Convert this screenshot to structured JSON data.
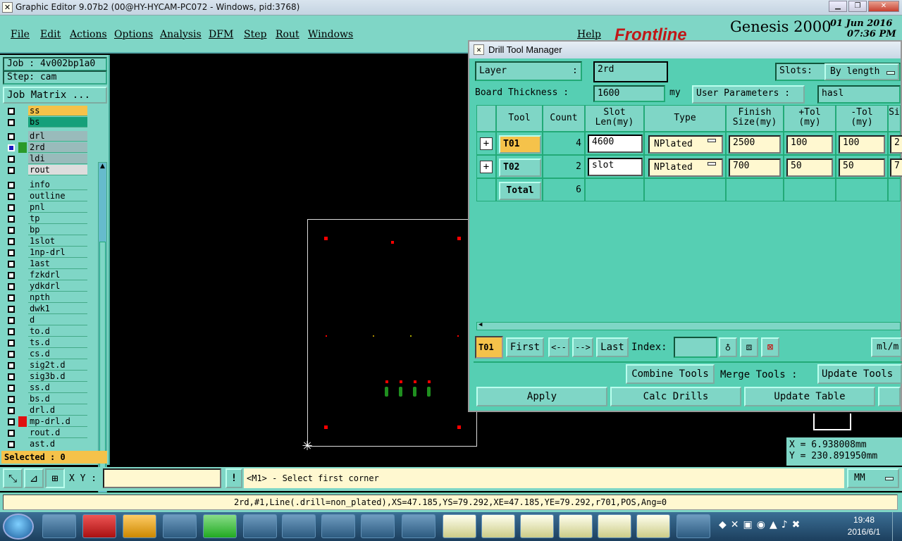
{
  "window": {
    "title": "Graphic Editor 9.07b2 (00@HY-HYCAM-PC072 - Windows, pid:3768)"
  },
  "menu": {
    "items": [
      "File",
      "Edit",
      "Actions",
      "Options",
      "Analysis",
      "DFM",
      "Step",
      "Rout",
      "Windows"
    ],
    "help": "Help"
  },
  "brand": {
    "logo": "Frontline",
    "product": "Genesis 2000",
    "date": "01 Jun 2016",
    "time": "07:36 PM",
    "ghost": "Graphic Editor"
  },
  "left": {
    "job": "Job : 4v002bp1a0",
    "step": "Step: cam",
    "job_matrix": "Job Matrix ...",
    "layers_top": [
      {
        "name": "ss",
        "color": "#f5c24a"
      },
      {
        "name": "bs",
        "color": "#15a07a"
      }
    ],
    "layers_drill": [
      {
        "name": "drl",
        "color": "#9bb"
      },
      {
        "name": "2rd",
        "color": "#9bb",
        "active": true
      },
      {
        "name": "ldi",
        "color": "#9bb"
      },
      {
        "name": "rout",
        "color": "#ddd"
      }
    ],
    "layers_misc": [
      {
        "name": "info"
      },
      {
        "name": "outline"
      },
      {
        "name": "pnl"
      },
      {
        "name": "tp"
      },
      {
        "name": "bp"
      },
      {
        "name": "1slot"
      },
      {
        "name": "1np-drl"
      },
      {
        "name": "1ast"
      },
      {
        "name": "fzkdrl"
      },
      {
        "name": "ydkdrl"
      },
      {
        "name": "npth"
      },
      {
        "name": "dwk1"
      },
      {
        "name": "d"
      },
      {
        "name": "to.d"
      },
      {
        "name": "ts.d"
      },
      {
        "name": "cs.d"
      },
      {
        "name": "sig2t.d"
      },
      {
        "name": "sig3b.d"
      },
      {
        "name": "ss.d"
      },
      {
        "name": "bs.d"
      },
      {
        "name": "drl.d"
      },
      {
        "name": "mp-drl.d"
      },
      {
        "name": "rout.d"
      },
      {
        "name": "ast.d"
      }
    ],
    "selected": "Selected : 0"
  },
  "dialog": {
    "title": "Drill Tool Manager",
    "layer_label": "Layer",
    "layer_sep": ":",
    "layer_value": "2rd",
    "slots_label": "Slots:",
    "slots_value": "By length",
    "thickness_label": "Board Thickness :",
    "thickness_value": "1600",
    "thickness_unit": "my",
    "user_params_label": "User Parameters :",
    "user_params_value": "hasl",
    "columns": [
      "Tool",
      "Count",
      "Slot\nLen(my)",
      "Type",
      "Finish\nSize(my)",
      "+Tol\n(my)",
      "-Tol\n(my)",
      "Si"
    ],
    "rows": [
      {
        "tool": "T01",
        "count": "4",
        "slot": "4600",
        "type": "NPlated",
        "finish": "2500",
        "ptol": "100",
        "ntol": "100",
        "si": "2"
      },
      {
        "tool": "T02",
        "count": "2",
        "slot": "slot",
        "type": "NPlated",
        "finish": "700",
        "ptol": "50",
        "ntol": "50",
        "si": "7"
      }
    ],
    "total_label": "Total",
    "total_count": "6",
    "nav": {
      "current": "T01",
      "first": "First",
      "prev": "<--",
      "next": "-->",
      "last": "Last",
      "index": "Index:",
      "units": "ml/m"
    },
    "buttons": {
      "combine": "Combine Tools",
      "merge": "Merge Tools :",
      "update_tools": "Update Tools",
      "apply": "Apply",
      "calc": "Calc Drills",
      "update_table": "Update Table"
    }
  },
  "coords": {
    "x": "X  =   6.938008mm",
    "y": "Y  = 230.891950mm"
  },
  "cmd": {
    "xy_label": "X Y :",
    "prompt": "<M1> - Select first corner",
    "units": "MM"
  },
  "status": "2rd,#1,Line(.drill=non_plated),XS=47.185,YS=79.292,XE=47.185,YE=79.292,r701,POS,Ang=0",
  "taskbar": {
    "time": "19:48",
    "date": "2016/6/1"
  },
  "colors": {
    "panel": "#7fd6c6",
    "dialog_bg": "#56cfb3",
    "highlight": "#f5c24a",
    "pad": "#ff0000",
    "slot": "#1f8f1f"
  }
}
